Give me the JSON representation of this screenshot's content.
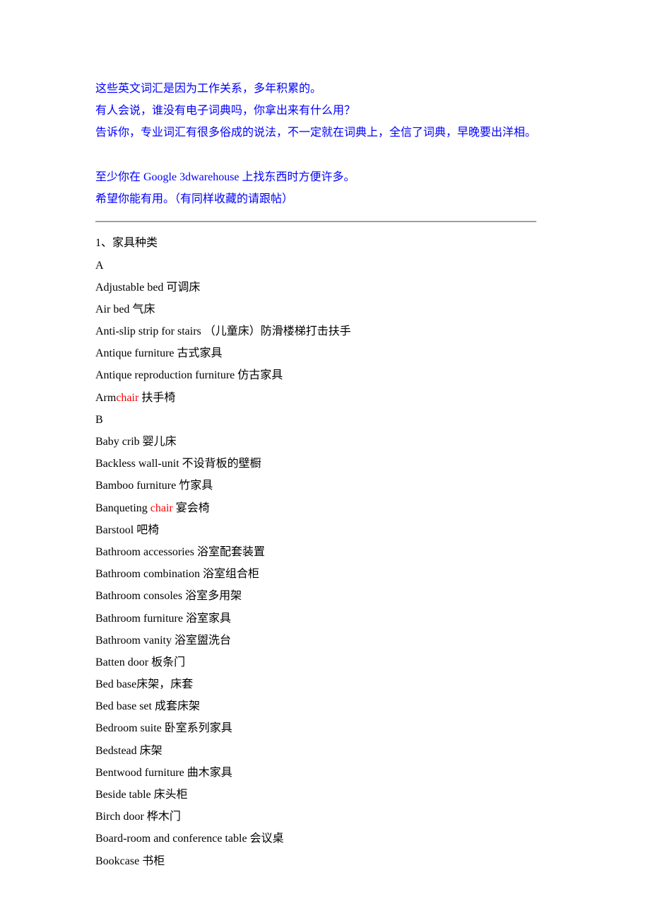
{
  "intro": [
    "这些英文词汇是因为工作关系，多年积累的。",
    "有人会说，谁没有电子词典吗，你拿出来有什么用？",
    "告诉你，专业词汇有很多俗成的说法，不一定就在词典上，全信了词典，早晚要出洋相。",
    "",
    "至少你在 Google 3dwarehouse 上找东西时方便许多。",
    "希望你能有用。（有同样收藏的请跟帖）"
  ],
  "divider": "———————————————————————————————————————",
  "section": {
    "heading": "1、家具种类",
    "groups": [
      {
        "letter": "A",
        "items": [
          {
            "en": "Adjustable bed",
            "zh": " 可调床"
          },
          {
            "en": "Air bed",
            "zh": " 气床"
          },
          {
            "en": "Anti-slip strip for stairs",
            "zh": " （儿童床）防滑楼梯打击扶手"
          },
          {
            "en": "Antique furniture",
            "zh": " 古式家具"
          },
          {
            "en": "Antique reproduction furniture",
            "zh": " 仿古家具"
          },
          {
            "en_pre": "Arm",
            "en_hl": "chair",
            "zh": " 扶手椅"
          }
        ]
      },
      {
        "letter": "B",
        "items": [
          {
            "en": "Baby crib",
            "zh": " 婴儿床"
          },
          {
            "en": "Backless wall-unit",
            "zh": " 不设背板的壁橱"
          },
          {
            "en": "Bamboo furniture",
            "zh": " 竹家具"
          },
          {
            "en_pre": "Banqueting ",
            "en_hl": "chair",
            "zh": " 宴会椅"
          },
          {
            "en": "Barstool",
            "zh": " 吧椅"
          },
          {
            "en": "Bathroom accessories",
            "zh": " 浴室配套装置"
          },
          {
            "en": "Bathroom combination",
            "zh": " 浴室组合柜"
          },
          {
            "en": "Bathroom consoles",
            "zh": " 浴室多用架"
          },
          {
            "en": "Bathroom furniture",
            "zh": " 浴室家具"
          },
          {
            "en": "Bathroom vanity",
            "zh": " 浴室盥洗台"
          },
          {
            "en": "Batten door",
            "zh": " 板条门"
          },
          {
            "en": "Bed base",
            "zh": "床架，床套"
          },
          {
            "en": "Bed base set",
            "zh": " 成套床架"
          },
          {
            "en": "Bedroom suite",
            "zh": " 卧室系列家具"
          },
          {
            "en": "Bedstead",
            "zh": " 床架"
          },
          {
            "en": "Bentwood furniture",
            "zh": " 曲木家具"
          },
          {
            "en": "Beside table",
            "zh": " 床头柜"
          },
          {
            "en": "Birch door",
            "zh": " 桦木门"
          },
          {
            "en": "Board-room and conference table",
            "zh": " 会议桌"
          },
          {
            "en": "Bookcase",
            "zh": " 书柜"
          }
        ]
      }
    ]
  }
}
